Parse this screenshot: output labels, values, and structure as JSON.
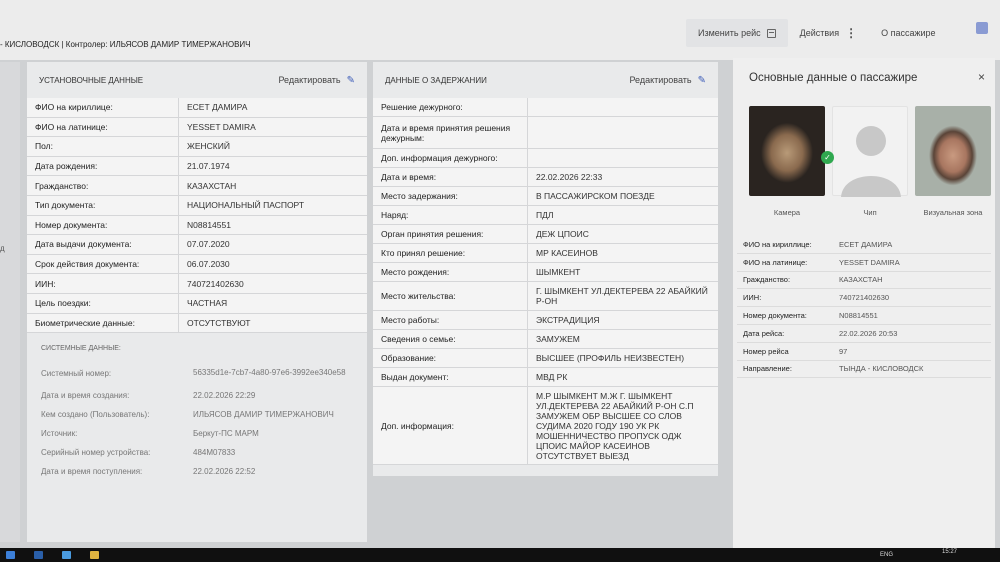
{
  "header": {
    "breadcrumb": "- КИСЛОВОДСК | Контролер: ИЛЬЯСОВ ДАМИР ТИМЕРЖАНОВИЧ",
    "change_route_label": "Изменить рейс",
    "actions_label": "Действия",
    "about_passenger_label": "О пассажире"
  },
  "left_strip_letter": "д",
  "setup_panel": {
    "title": "УСТАНОВОЧНЫЕ ДАННЫЕ",
    "edit_label": "Редактировать",
    "rows": [
      {
        "label": "ФИО на кириллице:",
        "value": "ЕСЕТ ДАМИРА"
      },
      {
        "label": "ФИО на латинице:",
        "value": "YESSET DAMIRA"
      },
      {
        "label": "Пол:",
        "value": "ЖЕНСКИЙ"
      },
      {
        "label": "Дата рождения:",
        "value": "21.07.1974"
      },
      {
        "label": "Гражданство:",
        "value": "КАЗАХСТАН"
      },
      {
        "label": "Тип документа:",
        "value": "НАЦИОНАЛЬНЫЙ ПАСПОРТ"
      },
      {
        "label": "Номер документа:",
        "value": "N08814551"
      },
      {
        "label": "Дата выдачи документа:",
        "value": "07.07.2020"
      },
      {
        "label": "Срок действия документа:",
        "value": "06.07.2030"
      },
      {
        "label": "ИИН:",
        "value": "740721402630"
      },
      {
        "label": "Цель поездки:",
        "value": "ЧАСТНАЯ"
      },
      {
        "label": "Биометрические данные:",
        "value": "ОТСУТСТВУЮТ"
      }
    ],
    "system": {
      "title": "СИСТЕМНЫЕ ДАННЫЕ:",
      "rows": [
        {
          "label": "Системный номер:",
          "value": "56335d1e-7cb7-4a80-97e6-3992ee340e58"
        },
        {
          "label": "Дата и время создания:",
          "value": "22.02.2026 22:29"
        },
        {
          "label": "Кем создано (Пользователь):",
          "value": "ИЛЬЯСОВ ДАМИР ТИМЕРЖАНОВИЧ"
        },
        {
          "label": "Источник:",
          "value": "Беркут-ПС МАРМ"
        },
        {
          "label": "Серийный номер устройства:",
          "value": "484M07833"
        },
        {
          "label": "Дата и время поступления:",
          "value": "22.02.2026 22:52"
        }
      ]
    }
  },
  "detention_panel": {
    "title": "ДАННЫЕ О ЗАДЕРЖАНИИ",
    "edit_label": "Редактировать",
    "rows": [
      {
        "label": "Решение дежурного:",
        "value": ""
      },
      {
        "label": "Дата и время принятия решения дежурным:",
        "value": ""
      },
      {
        "label": "Доп. информация дежурного:",
        "value": ""
      },
      {
        "label": "Дата и время:",
        "value": "22.02.2026 22:33"
      },
      {
        "label": "Место задержания:",
        "value": "В ПАССАЖИРСКОМ ПОЕЗДЕ"
      },
      {
        "label": "Наряд:",
        "value": "ПДЛ"
      },
      {
        "label": "Орган принятия решения:",
        "value": "ДЕЖ ЦПОИС"
      },
      {
        "label": "Кто принял решение:",
        "value": "МР КАСЕИНОВ"
      },
      {
        "label": "Место рождения:",
        "value": "ШЫМКЕНТ"
      },
      {
        "label": "Место жительства:",
        "value": "Г. ШЫМКЕНТ УЛ.ДЕКТЕРЕВА 22 АБАЙКИЙ Р-ОН"
      },
      {
        "label": "Место работы:",
        "value": "ЭКСТРАДИЦИЯ"
      },
      {
        "label": "Сведения о семье:",
        "value": "ЗАМУЖЕМ"
      },
      {
        "label": "Образование:",
        "value": "ВЫСШЕЕ (ПРОФИЛЬ НЕИЗВЕСТЕН)"
      },
      {
        "label": "Выдан документ:",
        "value": "МВД РК"
      },
      {
        "label": "Доп. информация:",
        "value": "М.Р ШЫМКЕНТ М.Ж Г. ШЫМКЕНТ УЛ.ДЕКТЕРЕВА 22 АБАЙКИЙ Р-ОН С.П ЗАМУЖЕМ ОБР ВЫСШЕЕ СО СЛОВ СУДИМА 2020 ГОДУ 190 УК РК МОШЕННИЧЕСТВО ПРОПУСК ОДЖ ЦПОИС МАЙОР КАСЕИНОВ ОТСУТСТВУЕТ ВЫЕЗД"
      }
    ]
  },
  "passenger_panel": {
    "title": "Основные данные о пассажире",
    "close": "×",
    "photo_captions": [
      "Камера",
      "Чип",
      "Визуальная зона"
    ],
    "rows": [
      {
        "label": "ФИО на кириллице:",
        "value": "ЕСЕТ ДАМИРА"
      },
      {
        "label": "ФИО на латинице:",
        "value": "YESSET DAMIRA"
      },
      {
        "label": "Гражданство:",
        "value": "КАЗАХСТАН"
      },
      {
        "label": "ИИН:",
        "value": "740721402630"
      },
      {
        "label": "Номер документа:",
        "value": "N08814551"
      },
      {
        "label": "Дата рейса:",
        "value": "22.02.2026 20:53"
      },
      {
        "label": "Номер рейса",
        "value": "97"
      },
      {
        "label": "Направление:",
        "value": "ТЫНДА - КИСЛОВОДСК"
      }
    ]
  },
  "taskbar": {
    "lang": "ENG",
    "time": "15:27"
  }
}
